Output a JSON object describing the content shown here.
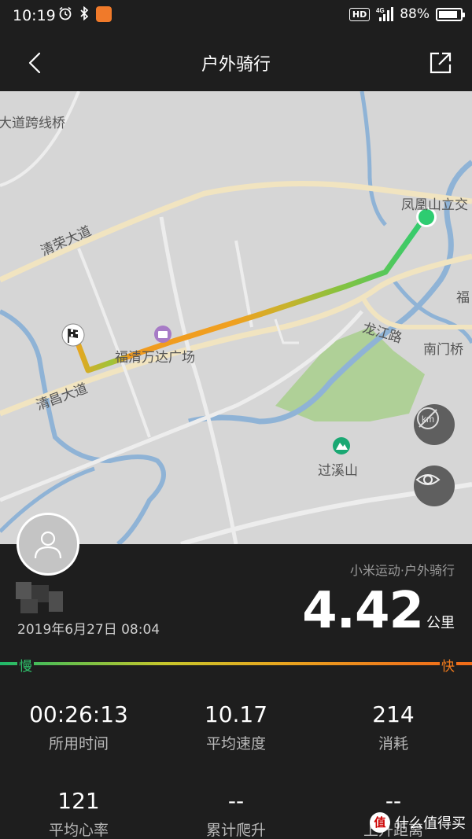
{
  "status_bar": {
    "time": "10:19",
    "hd": "HD",
    "network": "4G",
    "battery_pct": "88%",
    "battery_level": 0.88
  },
  "header": {
    "title": "户外骑行"
  },
  "map": {
    "labels": {
      "bridge": "大道跨线桥",
      "road_qingrong": "清荣大道",
      "road_qingchang": "清昌大道",
      "road_longjiang": "龙江路",
      "plaza": "福清万达广场",
      "fenghuang": "凤凰山立交",
      "nanmen": "南门桥",
      "fu": "福",
      "guoxi": "过溪山"
    }
  },
  "activity": {
    "source": "小米运动·户外骑行",
    "date": "2019年6月27日 08:04",
    "distance": "4.42",
    "distance_unit": "公里",
    "speed_slow": "慢",
    "speed_fast": "快"
  },
  "stats": [
    {
      "value": "00:26:13",
      "label": "所用时间"
    },
    {
      "value": "10.17",
      "label": "平均速度"
    },
    {
      "value": "214",
      "label": "消耗"
    },
    {
      "value": "121",
      "label": "平均心率"
    },
    {
      "value": "--",
      "label": "累计爬升"
    },
    {
      "value": "--",
      "label": "上升距离"
    }
  ],
  "watermark": {
    "logo": "值",
    "text": "什么值得买"
  },
  "colors": {
    "start_marker": "#2ecc71",
    "route_slow": "#2fbf6a",
    "route_fast": "#f07a1c",
    "panel_bg": "#1e1e1e"
  }
}
